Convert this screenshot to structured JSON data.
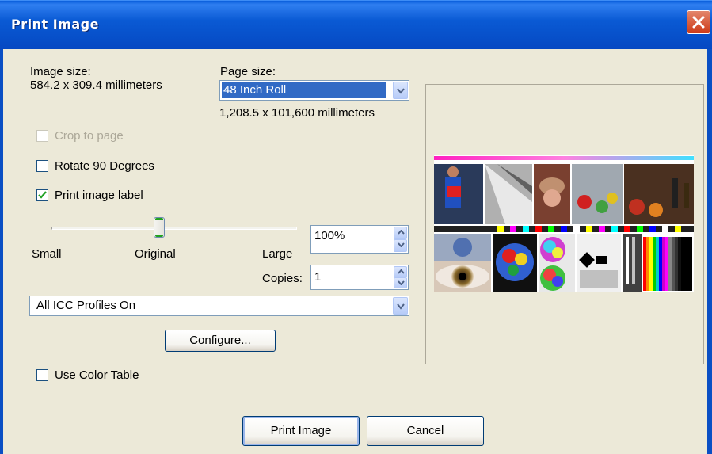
{
  "window": {
    "title": "Print Image",
    "close_icon": "close-icon"
  },
  "image_size": {
    "label": "Image size:",
    "value": "584.2 x 309.4 millimeters"
  },
  "page_size": {
    "label": "Page size:",
    "selected": "48 Inch Roll",
    "dimensions": "1,208.5 x 101,600 millimeters"
  },
  "options": {
    "crop_to_page": {
      "label": "Crop to page",
      "checked": false,
      "enabled": false
    },
    "rotate_90": {
      "label": "Rotate 90 Degrees",
      "checked": false,
      "enabled": true
    },
    "print_label": {
      "label": "Print image label",
      "checked": true,
      "enabled": true
    },
    "use_color_table": {
      "label": "Use Color Table",
      "checked": false,
      "enabled": true
    }
  },
  "label_size": {
    "small": "Small",
    "original": "Original",
    "large": "Large",
    "level_fraction": 0.45,
    "scale_value": "100%"
  },
  "copies": {
    "label": "Copies:",
    "value": "1"
  },
  "icc_profile": {
    "selected": "All ICC Profiles On"
  },
  "buttons": {
    "configure": "Configure...",
    "print": "Print Image",
    "cancel": "Cancel"
  },
  "colors": {
    "titlebar": "#0a5ad4",
    "dialog_bg": "#ece9d8",
    "selection": "#316ac5",
    "close_button": "#cd3a18"
  }
}
